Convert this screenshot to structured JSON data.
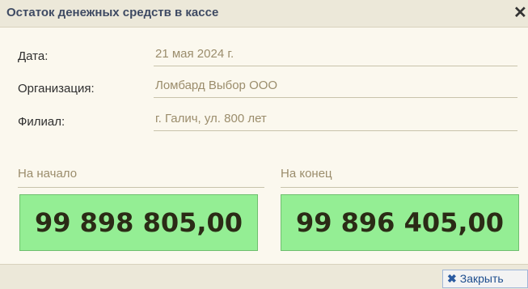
{
  "window": {
    "title": "Остаток денежных средств в кассе",
    "close_glyph": "✕"
  },
  "fields": {
    "date_label": "Дата:",
    "date_value": "21 мая 2024 г.",
    "org_label": "Организация:",
    "org_value": "Ломбард Выбор ООО",
    "branch_label": "Филиал:",
    "branch_value": "г. Галич, ул. 800 лет"
  },
  "balances": {
    "start_label": "На начало",
    "start_amount": "99 898 805,00",
    "end_label": "На конец",
    "end_amount": "99 896 405,00"
  },
  "footer": {
    "close_icon": "✖",
    "close_label": "Закрыть"
  },
  "colors": {
    "amount_background": "#94ee94",
    "title_text": "#3e4a63",
    "value_text": "#9b8d6c"
  }
}
